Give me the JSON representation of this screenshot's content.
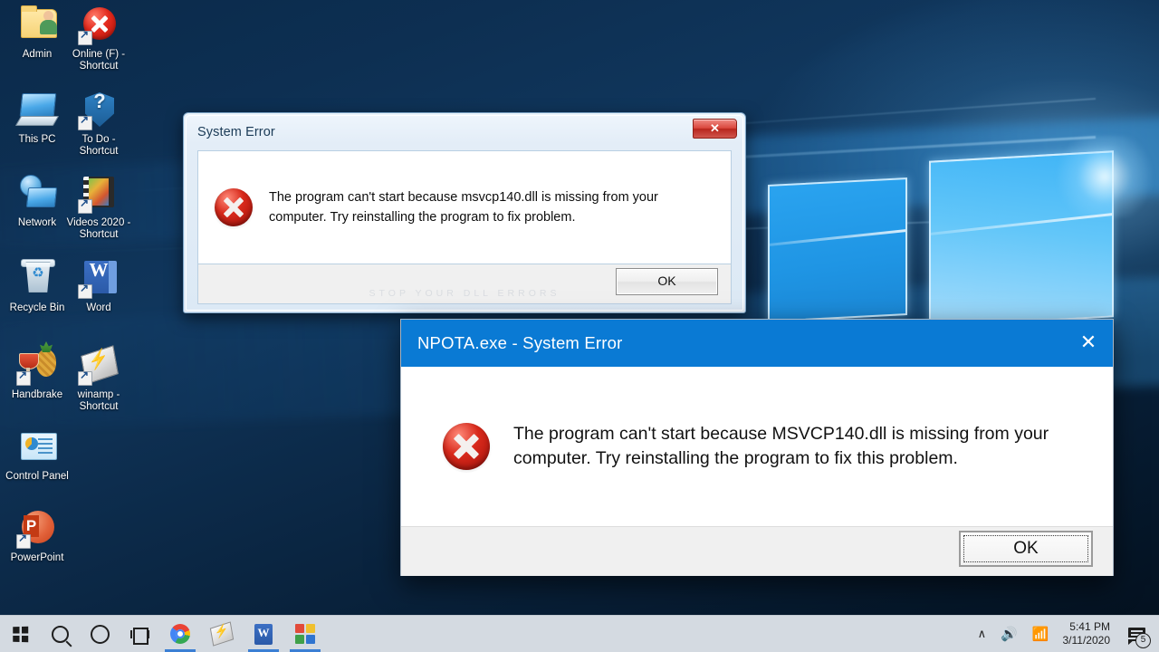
{
  "desktop": {
    "icons": [
      {
        "label": "Admin",
        "icon": "user-folder-icon",
        "shortcut": false
      },
      {
        "label": "Online (F) - Shortcut",
        "icon": "red-x-circle-icon",
        "shortcut": true
      },
      {
        "label": "This PC",
        "icon": "computer-icon",
        "shortcut": false
      },
      {
        "label": "To Do - Shortcut",
        "icon": "blue-shield-question-icon",
        "shortcut": true
      },
      {
        "label": "Network",
        "icon": "network-icon",
        "shortcut": false
      },
      {
        "label": "Videos 2020 - Shortcut",
        "icon": "film-strip-icon",
        "shortcut": true
      },
      {
        "label": "Recycle Bin",
        "icon": "recycle-bin-icon",
        "shortcut": false
      },
      {
        "label": "Word",
        "icon": "word-document-icon",
        "shortcut": true
      },
      {
        "label": "Handbrake",
        "icon": "handbrake-pineapple-icon",
        "shortcut": true
      },
      {
        "label": "winamp - Shortcut",
        "icon": "winamp-lightning-icon",
        "shortcut": true
      },
      {
        "label": "Control Panel",
        "icon": "control-panel-icon",
        "shortcut": false
      },
      {
        "label": "PowerPoint",
        "icon": "powerpoint-icon",
        "shortcut": true
      }
    ]
  },
  "dialog_win7": {
    "title": "System Error",
    "close_label": "✕",
    "error_icon": "error-x-circle-icon",
    "message": "The program can't start because msvcp140.dll is missing from your computer. Try reinstalling the program to fix problem.",
    "ok_label": "OK",
    "watermark": "STOP YOUR DLL ERRORS"
  },
  "dialog_win10": {
    "title": "NPOTA.exe - System Error",
    "close_label": "✕",
    "error_icon": "error-x-circle-icon",
    "message": "The program can't start because MSVCP140.dll is missing from your computer. Try reinstalling the program to fix this problem.",
    "ok_label": "OK",
    "title_bar_color": "#0a7ad4"
  },
  "taskbar": {
    "start_label": "Start",
    "search_label": "Search",
    "cortana_label": "Cortana",
    "task_view_label": "Task View",
    "apps": [
      {
        "name": "chrome",
        "label": "Google Chrome",
        "active": true
      },
      {
        "name": "winamp",
        "label": "winamp",
        "active": false
      },
      {
        "name": "word",
        "label": "Word",
        "active": true
      },
      {
        "name": "squares",
        "label": "Microsoft Store",
        "active": true
      }
    ],
    "tray": {
      "chevron": "∧",
      "volume": "🔊",
      "network": "📶",
      "time": "5:41 PM",
      "date": "3/11/2020",
      "notification_count": "5"
    }
  }
}
